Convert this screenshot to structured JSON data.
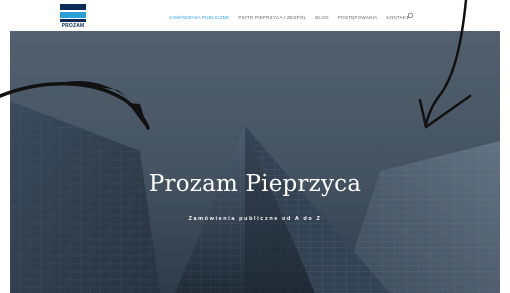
{
  "header": {
    "logo_text": "PROZAM",
    "nav": [
      {
        "label": "ZAMÓWIENIA PUBLICZNE",
        "active": true
      },
      {
        "label": "PIOTR PIEPRZYCA I ZESPÓŁ",
        "active": false
      },
      {
        "label": "BLOG",
        "active": false
      },
      {
        "label": "POSTĘPOWANIA",
        "active": false
      },
      {
        "label": "KONTAKT",
        "active": false
      }
    ],
    "search_icon": "search-icon"
  },
  "hero": {
    "title": "Prozam Pieprzyca",
    "subtitle": "Zamówienia publiczne od A do Z"
  },
  "colors": {
    "accent": "#2ea3f2",
    "logo_navy": "#0b2a57",
    "logo_blue": "#2a9fd6",
    "nav_text": "#666666"
  }
}
